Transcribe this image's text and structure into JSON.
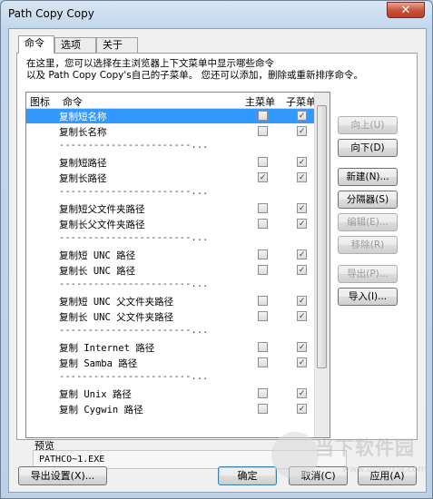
{
  "window": {
    "title": "Path Copy Copy",
    "close_glyph": "✕"
  },
  "tabs": [
    {
      "label": "命令"
    },
    {
      "label": "选项"
    },
    {
      "label": "关于"
    }
  ],
  "description": {
    "line1": "在这里，您可以选择在主浏览器上下文菜单中显示哪些命令",
    "line2": "以及 Path Copy Copy's自己的子菜单。 您还可以添加，删除或重新排序命令。"
  },
  "list": {
    "headers": {
      "icon": "图标",
      "command": "命令",
      "main_menu": "主菜单",
      "submenu": "子菜单"
    },
    "rows": [
      {
        "name": "复制短名称",
        "main": false,
        "sub": true,
        "selected": true
      },
      {
        "name": "复制长名称",
        "main": false,
        "sub": true
      },
      {
        "separator": "-----------------------..."
      },
      {
        "name": "复制短路径",
        "main": false,
        "sub": true
      },
      {
        "name": "复制长路径",
        "main": true,
        "sub": true
      },
      {
        "separator": "-----------------------..."
      },
      {
        "name": "复制短父文件夹路径",
        "main": false,
        "sub": true
      },
      {
        "name": "复制长父文件夹路径",
        "main": false,
        "sub": true
      },
      {
        "separator": "-----------------------..."
      },
      {
        "name": "复制短 UNC 路径",
        "main": false,
        "sub": true
      },
      {
        "name": "复制长 UNC 路径",
        "main": false,
        "sub": true
      },
      {
        "separator": "-----------------------..."
      },
      {
        "name": "复制短 UNC 父文件夹路径",
        "main": false,
        "sub": true
      },
      {
        "name": "复制长 UNC 父文件夹路径",
        "main": false,
        "sub": true
      },
      {
        "separator": "-----------------------..."
      },
      {
        "name": "复制 Internet 路径",
        "main": false,
        "sub": true
      },
      {
        "name": "复制 Samba 路径",
        "main": false,
        "sub": true
      },
      {
        "separator": "-----------------------..."
      },
      {
        "name": "复制 Unix 路径",
        "main": false,
        "sub": true
      },
      {
        "name": "复制 Cygwin 路径",
        "main": false,
        "sub": true
      }
    ]
  },
  "side_buttons": {
    "move_up": "向上(U)",
    "move_down": "向下(D)",
    "new": "新建(N)...",
    "separator": "分隔器(S)",
    "edit": "编辑(E)...",
    "remove": "移除(R)",
    "export": "导出(P)...",
    "import": "导入(I)..."
  },
  "preview": {
    "label": "预览",
    "value": "PATHCO~1.EXE"
  },
  "bottom_buttons": {
    "export_settings": "导出设置(X)...",
    "ok": "确定",
    "cancel": "取消(C)",
    "apply": "应用(A)"
  },
  "watermark": {
    "text": "当下软件园",
    "url": "www.downxia.com"
  }
}
